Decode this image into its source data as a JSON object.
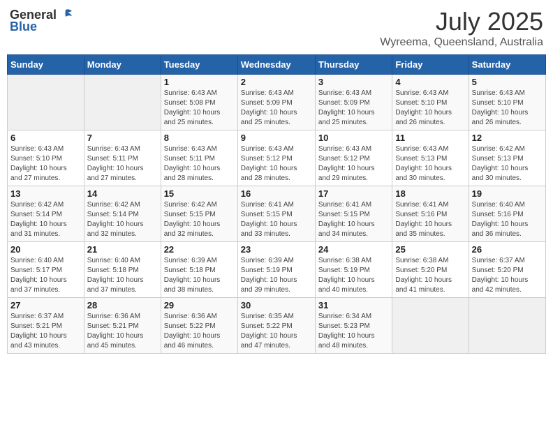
{
  "header": {
    "logo_general": "General",
    "logo_blue": "Blue",
    "month": "July 2025",
    "location": "Wyreema, Queensland, Australia"
  },
  "days_of_week": [
    "Sunday",
    "Monday",
    "Tuesday",
    "Wednesday",
    "Thursday",
    "Friday",
    "Saturday"
  ],
  "weeks": [
    [
      {
        "day": "",
        "info": ""
      },
      {
        "day": "",
        "info": ""
      },
      {
        "day": "1",
        "info": "Sunrise: 6:43 AM\nSunset: 5:08 PM\nDaylight: 10 hours\nand 25 minutes."
      },
      {
        "day": "2",
        "info": "Sunrise: 6:43 AM\nSunset: 5:09 PM\nDaylight: 10 hours\nand 25 minutes."
      },
      {
        "day": "3",
        "info": "Sunrise: 6:43 AM\nSunset: 5:09 PM\nDaylight: 10 hours\nand 25 minutes."
      },
      {
        "day": "4",
        "info": "Sunrise: 6:43 AM\nSunset: 5:10 PM\nDaylight: 10 hours\nand 26 minutes."
      },
      {
        "day": "5",
        "info": "Sunrise: 6:43 AM\nSunset: 5:10 PM\nDaylight: 10 hours\nand 26 minutes."
      }
    ],
    [
      {
        "day": "6",
        "info": "Sunrise: 6:43 AM\nSunset: 5:10 PM\nDaylight: 10 hours\nand 27 minutes."
      },
      {
        "day": "7",
        "info": "Sunrise: 6:43 AM\nSunset: 5:11 PM\nDaylight: 10 hours\nand 27 minutes."
      },
      {
        "day": "8",
        "info": "Sunrise: 6:43 AM\nSunset: 5:11 PM\nDaylight: 10 hours\nand 28 minutes."
      },
      {
        "day": "9",
        "info": "Sunrise: 6:43 AM\nSunset: 5:12 PM\nDaylight: 10 hours\nand 28 minutes."
      },
      {
        "day": "10",
        "info": "Sunrise: 6:43 AM\nSunset: 5:12 PM\nDaylight: 10 hours\nand 29 minutes."
      },
      {
        "day": "11",
        "info": "Sunrise: 6:43 AM\nSunset: 5:13 PM\nDaylight: 10 hours\nand 30 minutes."
      },
      {
        "day": "12",
        "info": "Sunrise: 6:42 AM\nSunset: 5:13 PM\nDaylight: 10 hours\nand 30 minutes."
      }
    ],
    [
      {
        "day": "13",
        "info": "Sunrise: 6:42 AM\nSunset: 5:14 PM\nDaylight: 10 hours\nand 31 minutes."
      },
      {
        "day": "14",
        "info": "Sunrise: 6:42 AM\nSunset: 5:14 PM\nDaylight: 10 hours\nand 32 minutes."
      },
      {
        "day": "15",
        "info": "Sunrise: 6:42 AM\nSunset: 5:15 PM\nDaylight: 10 hours\nand 32 minutes."
      },
      {
        "day": "16",
        "info": "Sunrise: 6:41 AM\nSunset: 5:15 PM\nDaylight: 10 hours\nand 33 minutes."
      },
      {
        "day": "17",
        "info": "Sunrise: 6:41 AM\nSunset: 5:15 PM\nDaylight: 10 hours\nand 34 minutes."
      },
      {
        "day": "18",
        "info": "Sunrise: 6:41 AM\nSunset: 5:16 PM\nDaylight: 10 hours\nand 35 minutes."
      },
      {
        "day": "19",
        "info": "Sunrise: 6:40 AM\nSunset: 5:16 PM\nDaylight: 10 hours\nand 36 minutes."
      }
    ],
    [
      {
        "day": "20",
        "info": "Sunrise: 6:40 AM\nSunset: 5:17 PM\nDaylight: 10 hours\nand 37 minutes."
      },
      {
        "day": "21",
        "info": "Sunrise: 6:40 AM\nSunset: 5:18 PM\nDaylight: 10 hours\nand 37 minutes."
      },
      {
        "day": "22",
        "info": "Sunrise: 6:39 AM\nSunset: 5:18 PM\nDaylight: 10 hours\nand 38 minutes."
      },
      {
        "day": "23",
        "info": "Sunrise: 6:39 AM\nSunset: 5:19 PM\nDaylight: 10 hours\nand 39 minutes."
      },
      {
        "day": "24",
        "info": "Sunrise: 6:38 AM\nSunset: 5:19 PM\nDaylight: 10 hours\nand 40 minutes."
      },
      {
        "day": "25",
        "info": "Sunrise: 6:38 AM\nSunset: 5:20 PM\nDaylight: 10 hours\nand 41 minutes."
      },
      {
        "day": "26",
        "info": "Sunrise: 6:37 AM\nSunset: 5:20 PM\nDaylight: 10 hours\nand 42 minutes."
      }
    ],
    [
      {
        "day": "27",
        "info": "Sunrise: 6:37 AM\nSunset: 5:21 PM\nDaylight: 10 hours\nand 43 minutes."
      },
      {
        "day": "28",
        "info": "Sunrise: 6:36 AM\nSunset: 5:21 PM\nDaylight: 10 hours\nand 45 minutes."
      },
      {
        "day": "29",
        "info": "Sunrise: 6:36 AM\nSunset: 5:22 PM\nDaylight: 10 hours\nand 46 minutes."
      },
      {
        "day": "30",
        "info": "Sunrise: 6:35 AM\nSunset: 5:22 PM\nDaylight: 10 hours\nand 47 minutes."
      },
      {
        "day": "31",
        "info": "Sunrise: 6:34 AM\nSunset: 5:23 PM\nDaylight: 10 hours\nand 48 minutes."
      },
      {
        "day": "",
        "info": ""
      },
      {
        "day": "",
        "info": ""
      }
    ]
  ]
}
